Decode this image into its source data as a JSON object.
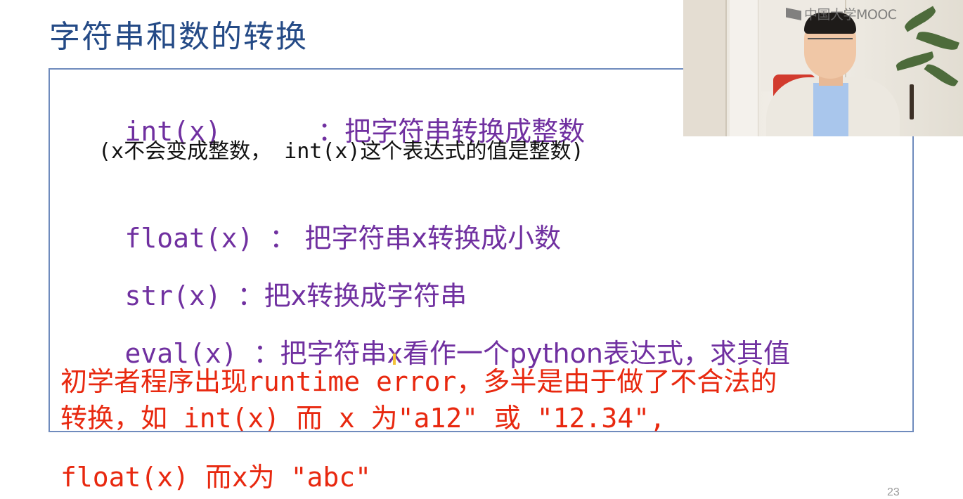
{
  "slide": {
    "title": "字符串和数的转换",
    "lines": {
      "int_code": "int(x)      ",
      "int_desc": "：把字符串转换成整数",
      "int_note": "(x不会变成整数， int(x)这个表达式的值是整数)",
      "float_code": "float(x) ：",
      "float_desc": " 把字符串x转换成小数",
      "str_code": "str(x) ：",
      "str_desc": "把x转换成字符串",
      "eval_code": "eval(x) ：",
      "eval_desc": "把字符串x看作一个python表达式，求其值",
      "warning_1": "初学者程序出现runtime error，多半是由于做了不合法的",
      "warning_2": "转换，如 int(x) 而 x 为\"a12\" 或 \"12.34\",",
      "warning_3": "float(x) 而x为 \"abc\""
    },
    "page_number": "23"
  },
  "webcam": {
    "logo_text": "中国大学MOOC"
  },
  "colors": {
    "title": "#244a86",
    "body_purple": "#7030a0",
    "note_black": "#111111",
    "warning_red": "#e8280f",
    "box_border": "#6f8bbd"
  }
}
